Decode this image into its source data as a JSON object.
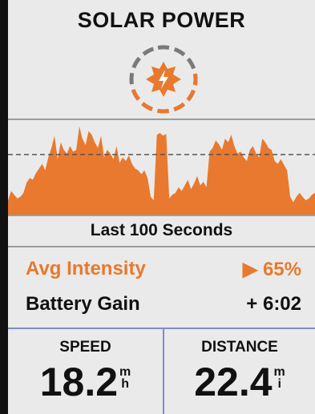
{
  "screen": {
    "title": "SOLAR POWER",
    "icon": "solar-sun-icon",
    "chart_caption": "Last 100 Seconds",
    "avg_intensity": {
      "label": "Avg Intensity",
      "value": "▶ 65%"
    },
    "battery_gain": {
      "label": "Battery Gain",
      "value": "+ 6:02"
    }
  },
  "fields": {
    "speed": {
      "label": "SPEED",
      "value": "18.2",
      "unit_top": "m",
      "unit_bottom": "h"
    },
    "distance": {
      "label": "DISTANCE",
      "value": "22.4",
      "unit_top": "m",
      "unit_bottom": "i"
    }
  },
  "colors": {
    "accent": "#e8792e",
    "divider": "#7b8bd1",
    "background": "#eaeaea"
  },
  "chart_data": {
    "type": "area",
    "average_fraction": 0.65,
    "values": [
      0.16,
      0.26,
      0.22,
      0.18,
      0.2,
      0.24,
      0.35,
      0.4,
      0.38,
      0.45,
      0.5,
      0.55,
      0.48,
      0.62,
      0.72,
      0.85,
      0.6,
      0.78,
      0.7,
      0.66,
      0.74,
      0.68,
      0.7,
      0.95,
      0.82,
      0.75,
      0.9,
      0.86,
      0.78,
      0.72,
      0.85,
      0.62,
      0.7,
      0.66,
      0.6,
      0.74,
      0.56,
      0.62,
      0.58,
      0.64,
      0.55,
      0.5,
      0.48,
      0.44,
      0.48,
      0.4,
      0.2,
      0.16,
      0.86,
      0.88,
      0.85,
      0.87,
      0.18,
      0.22,
      0.24,
      0.3,
      0.26,
      0.32,
      0.38,
      0.28,
      0.34,
      0.42,
      0.32,
      0.36,
      0.3,
      0.68,
      0.72,
      0.8,
      0.76,
      0.7,
      0.82,
      0.78,
      0.86,
      0.74,
      0.66,
      0.68,
      0.62,
      0.58,
      0.7,
      0.74,
      0.66,
      0.62,
      0.82,
      0.78,
      0.72,
      0.7,
      0.58,
      0.55,
      0.6,
      0.54,
      0.48,
      0.2,
      0.14,
      0.2,
      0.24,
      0.2,
      0.16,
      0.18,
      0.22,
      0.24
    ]
  }
}
